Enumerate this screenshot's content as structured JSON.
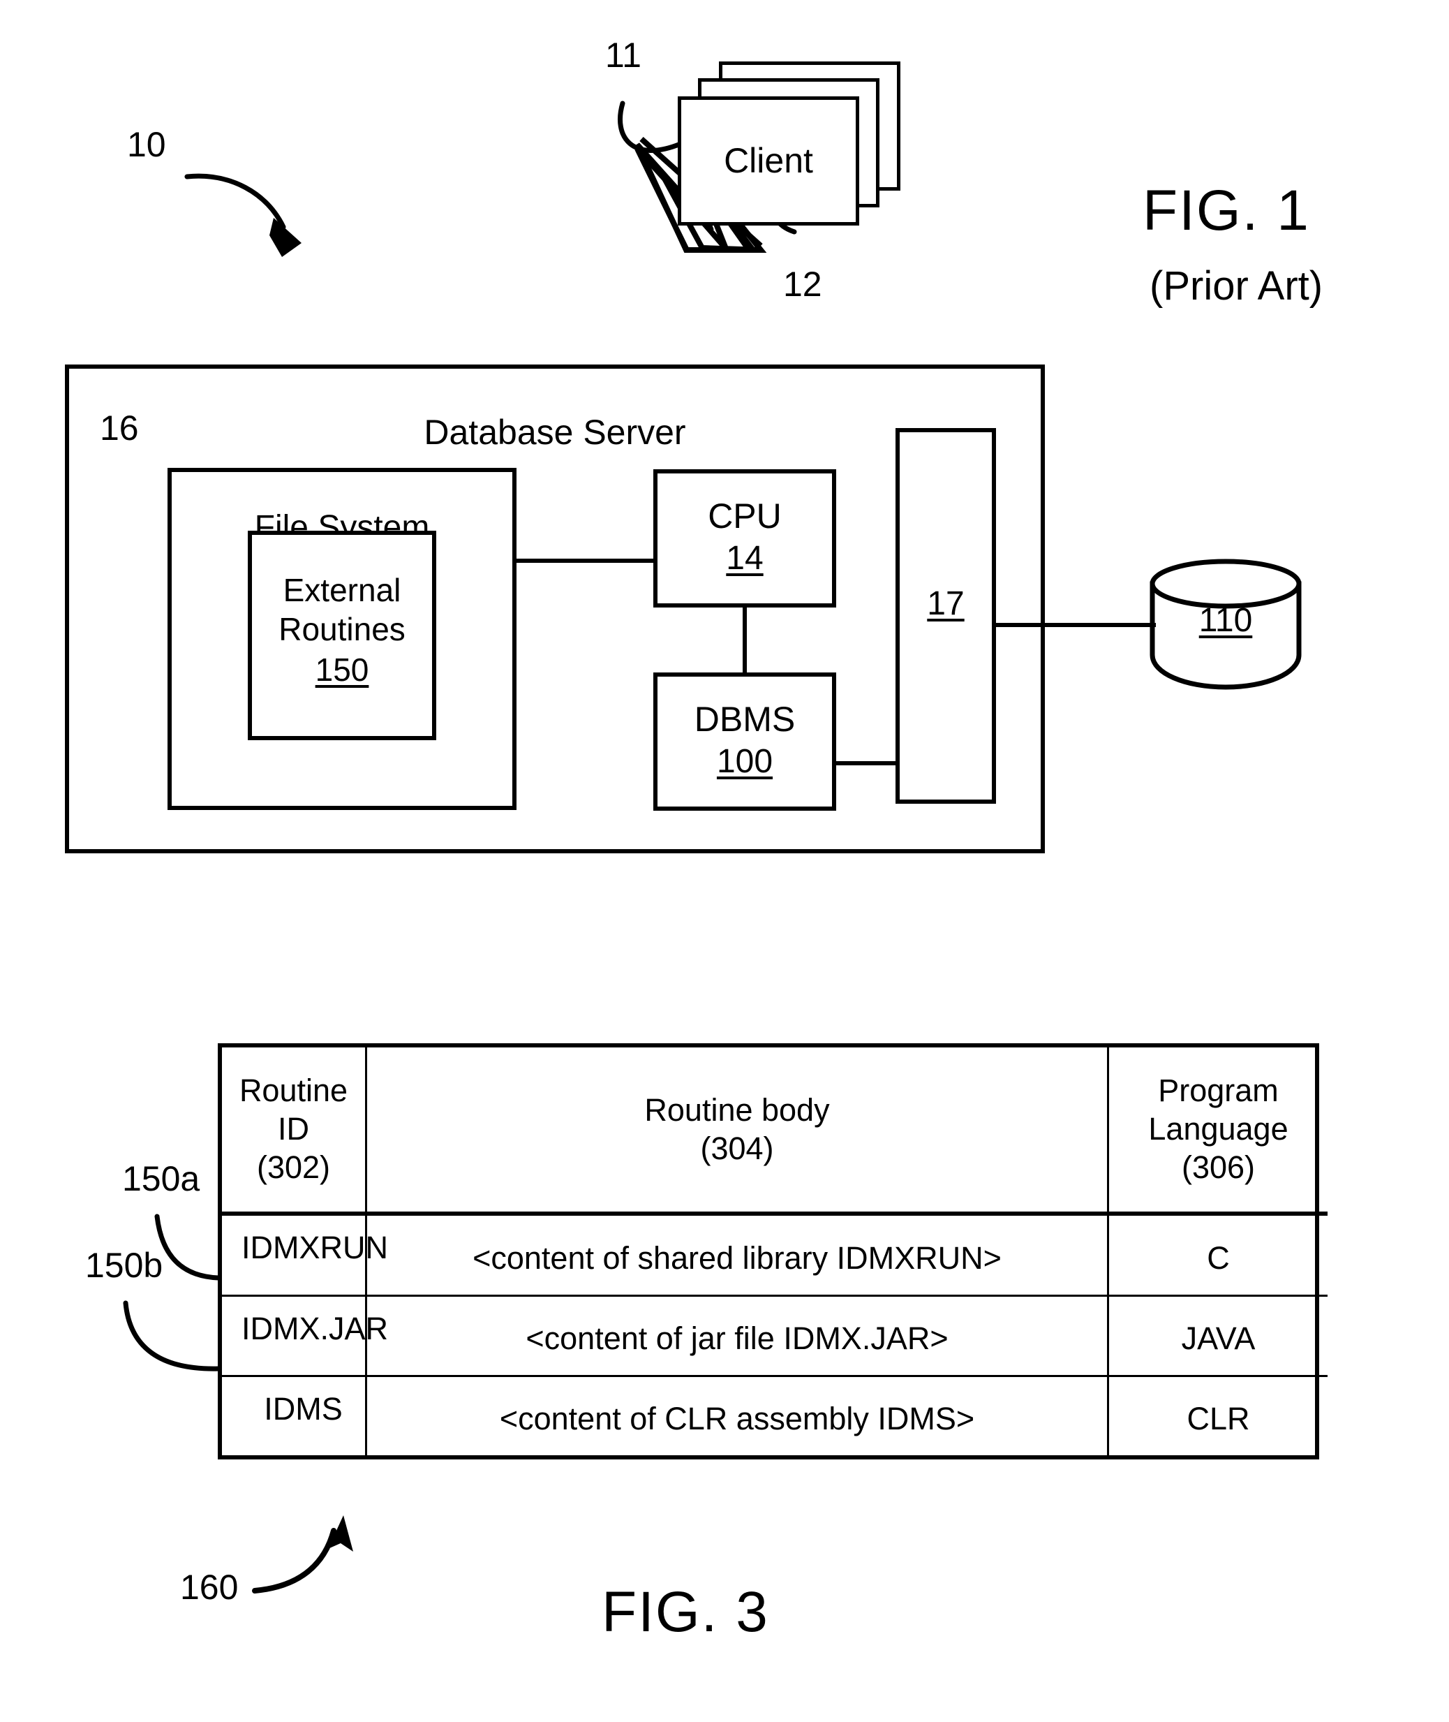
{
  "figure1": {
    "ref_10": "10",
    "ref_11": "11",
    "ref_12": "12",
    "ref_16": "16",
    "client_label": "Client",
    "server_label": "Database Server",
    "file_system_label": "File System",
    "external_routines_line1": "External",
    "external_routines_line2": "Routines",
    "external_routines_num": "150",
    "cpu_label": "CPU",
    "cpu_num": "14",
    "dbms_label": "DBMS",
    "dbms_num": "100",
    "interface_num": "17",
    "database_num": "110",
    "title": "FIG. 1",
    "subtitle": "(Prior Art)"
  },
  "figure3": {
    "ref_150a": "150a",
    "ref_150b": "150b",
    "ref_160": "160",
    "title": "FIG. 3",
    "columns": [
      {
        "name": "Routine ID",
        "ref": "(302)"
      },
      {
        "name": "Routine body",
        "ref": "(304)"
      },
      {
        "name": "Program\nLanguage",
        "ref": "(306)",
        "line1": "Program",
        "line2": "Language"
      }
    ],
    "header": {
      "c1_line1": "Routine ID",
      "c1_line2": "(302)",
      "c2_line1": "Routine body",
      "c2_line2": "(304)",
      "c3_line1": "Program",
      "c3_line2": "Language",
      "c3_line3": "(306)"
    },
    "rows": [
      {
        "routine_id": "IDMXRUN",
        "routine_body": "<content of shared library IDMXRUN>",
        "program_language": "C"
      },
      {
        "routine_id": "IDMX.JAR",
        "routine_body": "<content of jar file IDMX.JAR>",
        "program_language": "JAVA"
      },
      {
        "routine_id": "IDMS",
        "routine_body": "<content of CLR assembly  IDMS>",
        "program_language": "CLR"
      }
    ]
  },
  "colors": {
    "ink": "#000000",
    "paper": "#ffffff"
  }
}
